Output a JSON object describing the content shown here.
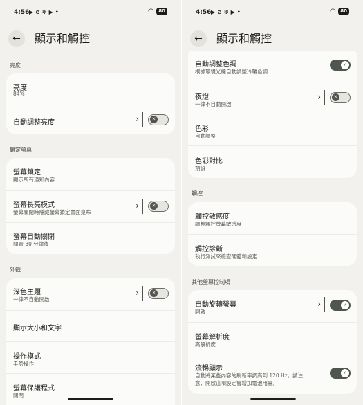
{
  "status": {
    "time": "4:56",
    "battery": "80"
  },
  "left": {
    "title": "顯示和觸控",
    "sections": {
      "brightness": "亮度",
      "lock": "鎖定螢幕",
      "appearance": "外觀"
    },
    "brightness_level": {
      "title": "亮度",
      "value": "84%"
    },
    "auto_brightness": {
      "title": "自動調整亮度"
    },
    "screen_lock": {
      "title": "螢幕鎖定",
      "subtitle": "顯示所有通知內容"
    },
    "always_on": {
      "title": "螢幕長亮模式",
      "subtitle": "螢幕關閉時隱藏螢幕鎖定畫面桌布"
    },
    "auto_off": {
      "title": "螢幕自動關閉",
      "subtitle": "閒置 30 分鐘後"
    },
    "dark_theme": {
      "title": "深色主題",
      "subtitle": "一律不自動開啟"
    },
    "display_size": {
      "title": "顯示大小和文字"
    },
    "nav_mode": {
      "title": "操作模式",
      "subtitle": "手勢操作"
    },
    "screensaver": {
      "title": "螢幕保護程式",
      "subtitle": "關閉"
    }
  },
  "right": {
    "title": "顯示和觸控",
    "sections": {
      "touch": "觸控",
      "other": "其他螢幕控制項"
    },
    "auto_color_temp": {
      "title": "自動調整色調",
      "subtitle": "根據環境光線自動調整冷暖色調"
    },
    "night_light": {
      "title": "夜燈",
      "subtitle": "一律不自動開啟"
    },
    "colors": {
      "title": "色彩",
      "subtitle": "自動調整"
    },
    "contrast": {
      "title": "色彩對比",
      "subtitle": "預設"
    },
    "touch_sensitivity": {
      "title": "觸控敏感度",
      "subtitle": "調整觸控螢幕敏感度"
    },
    "touch_diagnostics": {
      "title": "觸控診斷",
      "subtitle": "執行測試來檢查硬體和設定"
    },
    "auto_rotate": {
      "title": "自動旋轉螢幕",
      "subtitle": "開啟"
    },
    "resolution": {
      "title": "螢幕解析度",
      "subtitle": "高解析度"
    },
    "smooth_display": {
      "title": "流暢顯示",
      "subtitle_line1": "自動將某些內容的刷新率調高到 120 Hz。請注",
      "subtitle_line2": "意，開啟這項設定會增加電池用量。"
    }
  }
}
